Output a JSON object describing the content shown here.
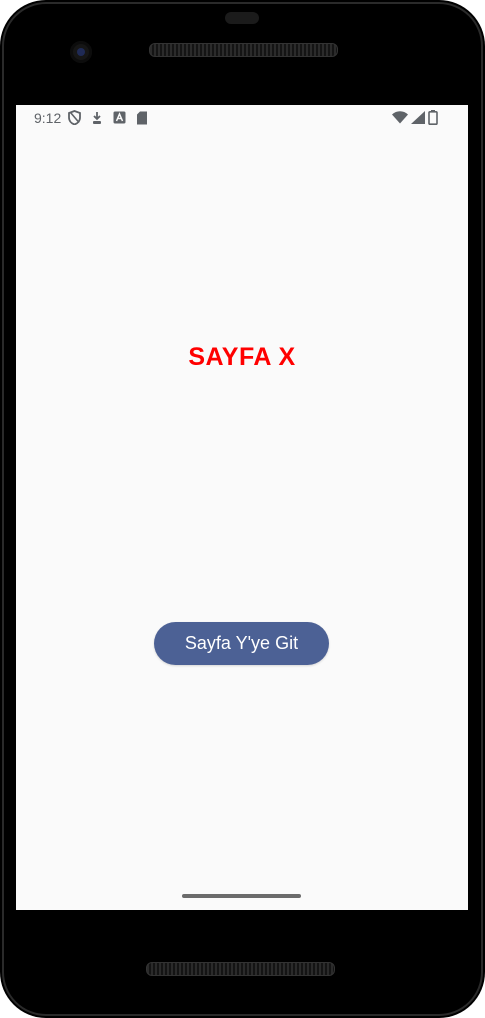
{
  "status_bar": {
    "time": "9:12",
    "left_icons": [
      "shield-icon",
      "download-icon",
      "font-a-icon",
      "sd-card-icon"
    ],
    "right_icons": [
      "wifi-icon",
      "signal-icon",
      "battery-icon"
    ]
  },
  "page": {
    "title": "SAYFA X",
    "title_color": "#ff0000",
    "background": "#fafafa"
  },
  "actions": {
    "go_button_label": "Sayfa Y'ye Git",
    "go_button_color": "#4c6195"
  }
}
